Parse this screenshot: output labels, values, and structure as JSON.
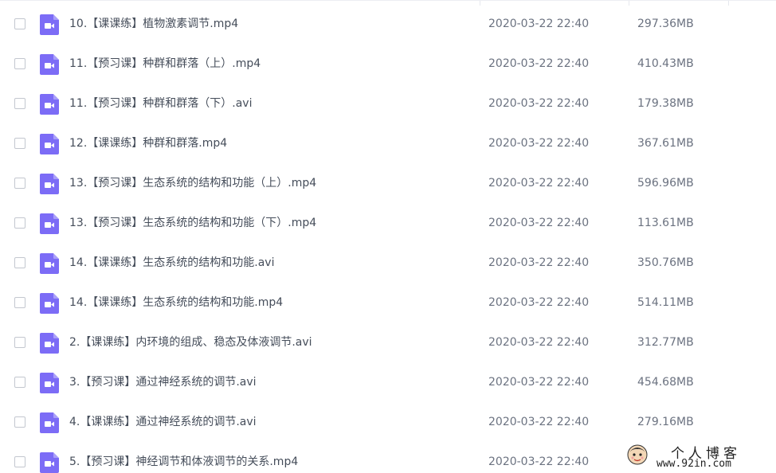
{
  "files": [
    {
      "name": "10.【课课练】植物激素调节.mp4",
      "date": "2020-03-22 22:40",
      "size": "297.36MB"
    },
    {
      "name": "11.【预习课】种群和群落（上）.mp4",
      "date": "2020-03-22 22:40",
      "size": "410.43MB"
    },
    {
      "name": "11.【预习课】种群和群落（下）.avi",
      "date": "2020-03-22 22:40",
      "size": "179.38MB"
    },
    {
      "name": "12.【课课练】种群和群落.mp4",
      "date": "2020-03-22 22:40",
      "size": "367.61MB"
    },
    {
      "name": "13.【预习课】生态系统的结构和功能（上）.mp4",
      "date": "2020-03-22 22:40",
      "size": "596.96MB"
    },
    {
      "name": "13.【预习课】生态系统的结构和功能（下）.mp4",
      "date": "2020-03-22 22:40",
      "size": "113.61MB"
    },
    {
      "name": "14.【课课练】生态系统的结构和功能.avi",
      "date": "2020-03-22 22:40",
      "size": "350.76MB"
    },
    {
      "name": "14.【课课练】生态系统的结构和功能.mp4",
      "date": "2020-03-22 22:40",
      "size": "514.11MB"
    },
    {
      "name": "2.【课课练】内环境的组成、稳态及体液调节.avi",
      "date": "2020-03-22 22:40",
      "size": "312.77MB"
    },
    {
      "name": "3.【预习课】通过神经系统的调节.avi",
      "date": "2020-03-22 22:40",
      "size": "454.68MB"
    },
    {
      "name": "4.【课课练】通过神经系统的调节.avi",
      "date": "2020-03-22 22:40",
      "size": "279.16MB"
    },
    {
      "name": "5.【预习课】神经调节和体液调节的关系.mp4",
      "date": "2020-03-22 22:40",
      "size": ""
    }
  ],
  "icon": {
    "name": "video-file-icon",
    "color": "#7c6cf6"
  },
  "watermark": {
    "title": "个人博客",
    "url": "www.92in.com"
  }
}
